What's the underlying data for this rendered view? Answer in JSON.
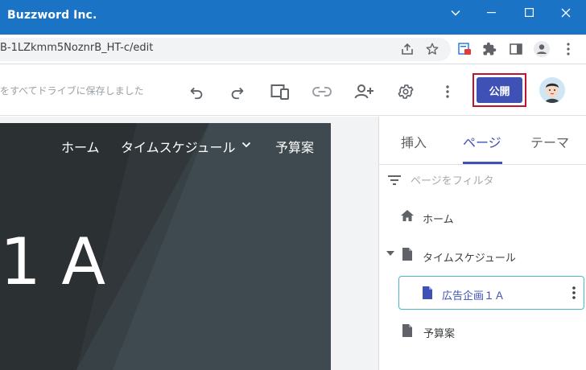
{
  "window": {
    "title": "Buzzword Inc.",
    "controls": [
      "chevron-down-icon",
      "minimize-icon",
      "maximize-icon",
      "close-icon"
    ]
  },
  "address_bar": {
    "url": "B-1LZkmm5NoznrB_HT-c/edit",
    "icons": [
      "share-icon",
      "star-icon",
      "extension-pdf-icon",
      "puzzle-icon",
      "side-panel-icon",
      "profile-icon",
      "more-vert-icon"
    ]
  },
  "toolbar": {
    "save_status": "をすべてドライブに保存しました",
    "buttons": [
      "undo-icon",
      "redo-icon",
      "preview-icon",
      "link-icon",
      "share-person-icon",
      "settings-icon",
      "more-vert-icon"
    ],
    "publish_label": "公開"
  },
  "site": {
    "nav": {
      "home": "ホーム",
      "schedule": "タイムスケジュール",
      "budget": "予算案"
    },
    "hero_title": "1 A"
  },
  "panel": {
    "tabs": [
      "挿入",
      "ページ",
      "テーマ"
    ],
    "active_tab": "ページ",
    "filter_placeholder": "ページをフィルタ",
    "pages": [
      {
        "label": "ホーム",
        "icon": "home-icon"
      },
      {
        "label": "タイムスケジュール",
        "icon": "page-icon",
        "expanded": true
      },
      {
        "label": "広告企画１Ａ",
        "icon": "page-icon",
        "selected": true
      },
      {
        "label": "予算案",
        "icon": "page-icon"
      }
    ]
  },
  "colors": {
    "titlebar": "#1a73c5",
    "accent": "#3f51b5",
    "publish_outline": "#c3112a",
    "selection_border": "#4fb6c7"
  }
}
